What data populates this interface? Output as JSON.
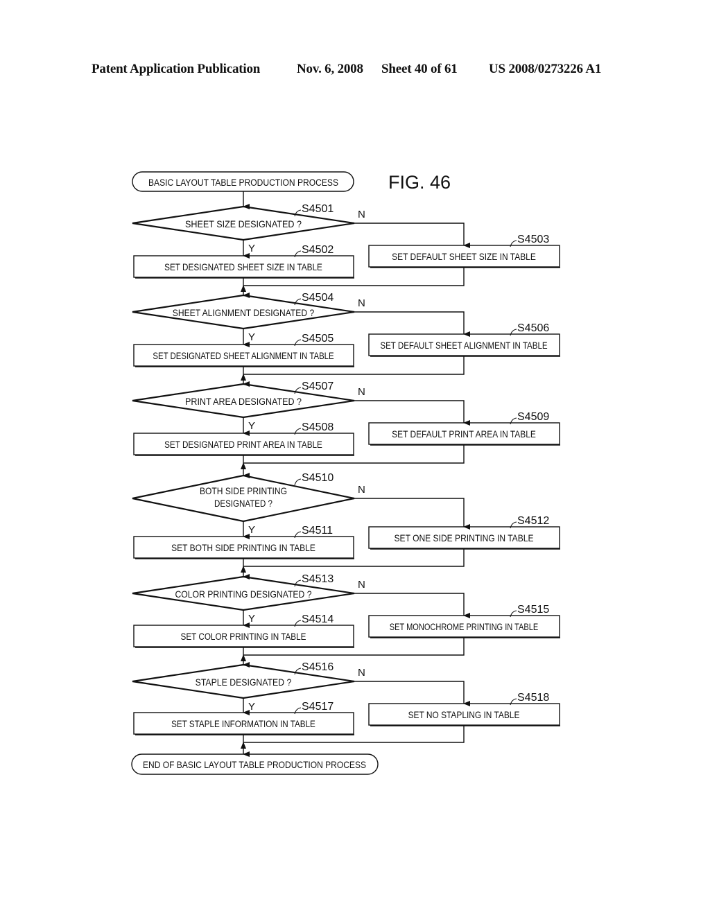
{
  "header": {
    "publication": "Patent Application Publication",
    "date": "Nov. 6, 2008",
    "sheet": "Sheet 40 of 61",
    "number": "US 2008/0273226 A1"
  },
  "figure": {
    "title": "FIG. 46",
    "start": "BASIC LAYOUT TABLE PRODUCTION PROCESS",
    "end": "END OF BASIC LAYOUT TABLE PRODUCTION PROCESS",
    "yes_label": "Y",
    "no_label": "N",
    "decisions": [
      {
        "id": "S4501",
        "lines": [
          "SHEET SIZE DESIGNATED ?"
        ],
        "yes": {
          "id": "S4502",
          "text": "SET DESIGNATED SHEET SIZE IN TABLE"
        },
        "no": {
          "id": "S4503",
          "text": "SET DEFAULT SHEET SIZE IN TABLE"
        }
      },
      {
        "id": "S4504",
        "lines": [
          "SHEET ALIGNMENT DESIGNATED ?"
        ],
        "yes": {
          "id": "S4505",
          "text": "SET DESIGNATED SHEET ALIGNMENT IN TABLE"
        },
        "no": {
          "id": "S4506",
          "text": "SET DEFAULT SHEET ALIGNMENT IN TABLE"
        }
      },
      {
        "id": "S4507",
        "lines": [
          "PRINT AREA DESIGNATED ?"
        ],
        "yes": {
          "id": "S4508",
          "text": "SET DESIGNATED PRINT AREA IN TABLE"
        },
        "no": {
          "id": "S4509",
          "text": "SET DEFAULT PRINT AREA IN TABLE"
        }
      },
      {
        "id": "S4510",
        "lines": [
          "BOTH SIDE PRINTING",
          "DESIGNATED ?"
        ],
        "yes": {
          "id": "S4511",
          "text": "SET BOTH SIDE PRINTING IN TABLE"
        },
        "no": {
          "id": "S4512",
          "text": "SET ONE SIDE PRINTING IN TABLE"
        }
      },
      {
        "id": "S4513",
        "lines": [
          "COLOR PRINTING DESIGNATED ?"
        ],
        "yes": {
          "id": "S4514",
          "text": "SET COLOR PRINTING IN TABLE"
        },
        "no": {
          "id": "S4515",
          "text": "SET MONOCHROME PRINTING IN TABLE"
        }
      },
      {
        "id": "S4516",
        "lines": [
          "STAPLE DESIGNATED ?"
        ],
        "yes": {
          "id": "S4517",
          "text": "SET STAPLE INFORMATION IN TABLE"
        },
        "no": {
          "id": "S4518",
          "text": "SET NO STAPLING IN TABLE"
        }
      }
    ]
  }
}
